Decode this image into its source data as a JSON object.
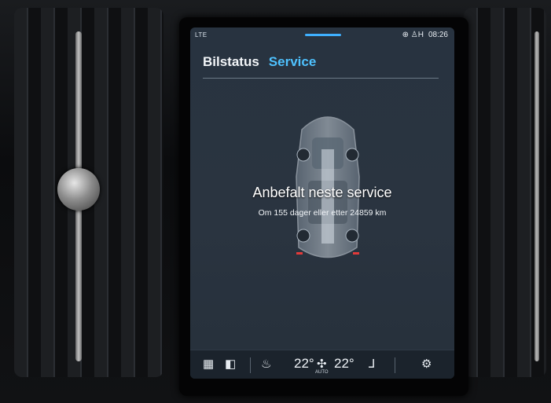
{
  "status_bar": {
    "network": "LTE",
    "indicators": "⊕ ♙H",
    "time": "08:26"
  },
  "tabs": [
    {
      "label": "Bilstatus",
      "active": false
    },
    {
      "label": "Service",
      "active": true
    }
  ],
  "service": {
    "headline": "Anbefalt neste service",
    "detail": "Om 155 dager eller etter 24859 km"
  },
  "climate_bar": {
    "left_temp": "22°",
    "right_temp": "22°",
    "fan_mode": "AUTO"
  },
  "icons": [
    "grid-icon",
    "camera-icon",
    "heated-seat-icon",
    "fan-icon",
    "seat-icon",
    "settings-gear-icon"
  ],
  "colors": {
    "active_tab": "#4ec2ff",
    "screen_bg": "#283340"
  }
}
